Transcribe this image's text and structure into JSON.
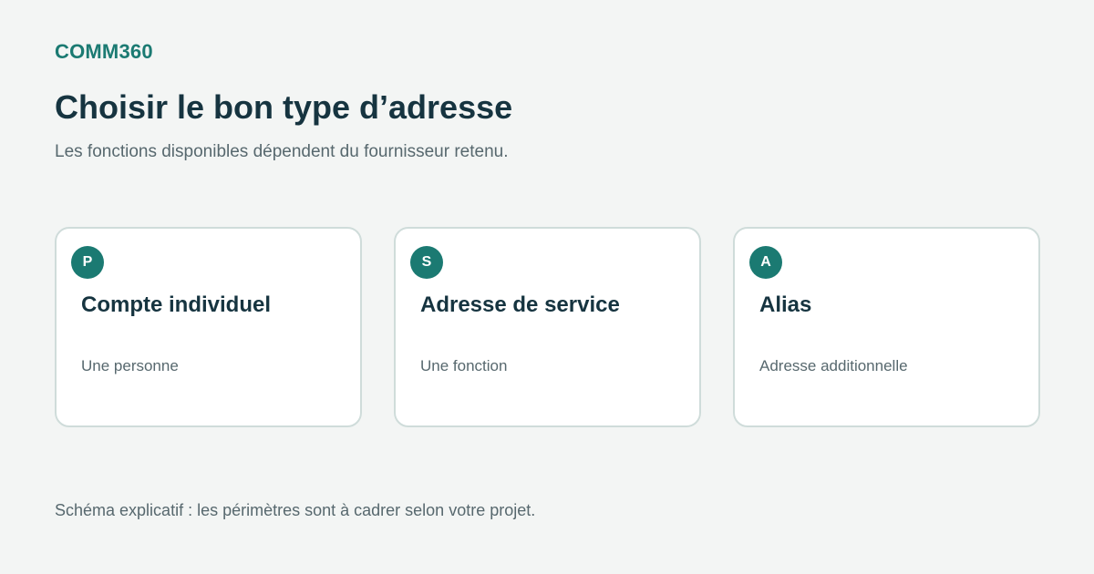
{
  "brand": "COMM360",
  "title": "Choisir le bon type d’adresse",
  "subtitle": "Les fonctions disponibles dépendent du fournisseur retenu.",
  "cards": [
    {
      "badge": "P",
      "title": "Compte individuel",
      "description": "Une personne"
    },
    {
      "badge": "S",
      "title": "Adresse de service",
      "description": "Une fonction"
    },
    {
      "badge": "A",
      "title": "Alias",
      "description": "Adresse additionnelle"
    }
  ],
  "footnote": "Schéma explicatif : les périmètres sont à cadrer selon votre projet.",
  "colors": {
    "accent": "#1b7a72",
    "heading": "#163440",
    "muted": "#57686e",
    "background": "#f3f5f4",
    "card_border": "#cfdcda"
  }
}
